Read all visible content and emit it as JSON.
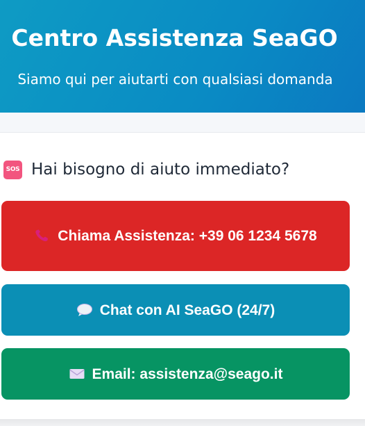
{
  "header": {
    "title": "Centro Assistenza SeaGO",
    "subtitle": "Siamo qui per aiutarti con qualsiasi domanda"
  },
  "help": {
    "icon": "sos-icon",
    "icon_text": "SOS",
    "title": "Hai bisogno di aiuto immediato?"
  },
  "actions": [
    {
      "icon": "phone-icon",
      "label": "Chiama Assistenza: +39 06 1234 5678",
      "color": "#dc2626"
    },
    {
      "icon": "chat-bubble-icon",
      "label": "Chat con AI SeaGO (24/7)",
      "color": "#0b8fb5"
    },
    {
      "icon": "envelope-icon",
      "label": "Email: assistenza@seago.it",
      "color": "#079463"
    }
  ],
  "colors": {
    "header_gradient_start": "#0e9bc4",
    "header_gradient_end": "#0b79c1",
    "call": "#dc2626",
    "chat": "#0b8fb5",
    "email": "#079463"
  }
}
